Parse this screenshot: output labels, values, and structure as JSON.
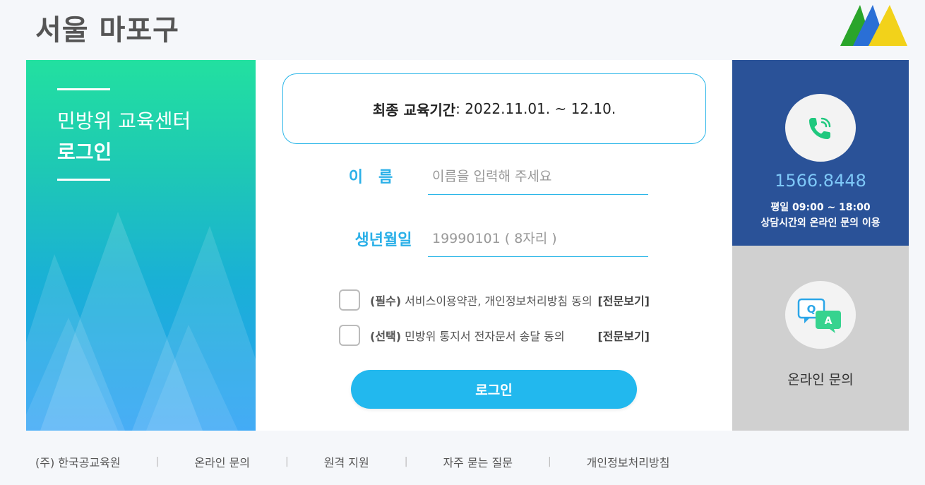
{
  "header": {
    "title": "서울 마포구"
  },
  "left_panel": {
    "title": "민방위 교육센터",
    "subtitle": "로그인"
  },
  "period": {
    "label": "최종 교육기간",
    "value": " : 2022.11.01. ~ 12.10."
  },
  "form": {
    "name_label": "이　름",
    "name_placeholder": "이름을 입력해 주세요",
    "birth_label": "생년월일",
    "birth_placeholder": "19990101 ( 8자리 )"
  },
  "agreements": [
    {
      "tag": "(필수)",
      "text": " 서비스이용약관, 개인정보처리방침 동의",
      "link": "[전문보기]"
    },
    {
      "tag": "(선택)",
      "text": " 민방위 통지서 전자문서 송달 동의",
      "link": "[전문보기]"
    }
  ],
  "login_button": "로그인",
  "phone": {
    "number": "1566.8448",
    "hours": "평일 09:00 ~ 18:00",
    "note": "상담시간외 온라인 문의 이용",
    "icon": "phone-icon",
    "accent": "#2a5298"
  },
  "qa": {
    "label": "온라인 문의",
    "icon": "qa-chat-icon"
  },
  "footer": {
    "items": [
      "(주) 한국공교육원",
      "온라인 문의",
      "원격 지원",
      "자주 묻는 질문",
      "개인정보처리방침"
    ],
    "separator": "|"
  }
}
